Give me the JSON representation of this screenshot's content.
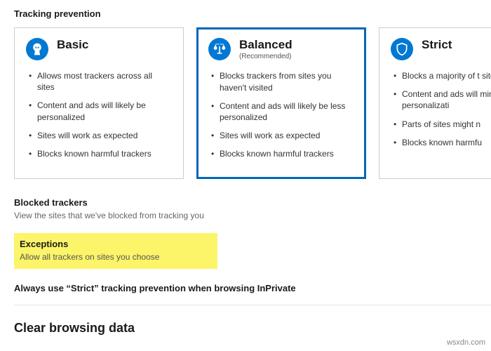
{
  "section_title": "Tracking prevention",
  "cards": {
    "basic": {
      "title": "Basic",
      "bullets": [
        "Allows most trackers across all sites",
        "Content and ads will likely be personalized",
        "Sites will work as expected",
        "Blocks known harmful trackers"
      ]
    },
    "balanced": {
      "title": "Balanced",
      "subtitle": "(Recommended)",
      "bullets": [
        "Blocks trackers from sites you haven't visited",
        "Content and ads will likely be less personalized",
        "Sites will work as expected",
        "Blocks known harmful trackers"
      ]
    },
    "strict": {
      "title": "Strict",
      "bullets": [
        "Blocks a majority of t sites",
        "Content and ads will minimal personalizati",
        "Parts of sites might n",
        "Blocks known harmfu"
      ]
    }
  },
  "blocked": {
    "title": "Blocked trackers",
    "desc": "View the sites that we've blocked from tracking you"
  },
  "exceptions": {
    "title": "Exceptions",
    "desc": "Allow all trackers on sites you choose"
  },
  "strict_always": "Always use “Strict” tracking prevention when browsing InPrivate",
  "clear_heading": "Clear browsing data",
  "watermark": "wsxdn.com"
}
